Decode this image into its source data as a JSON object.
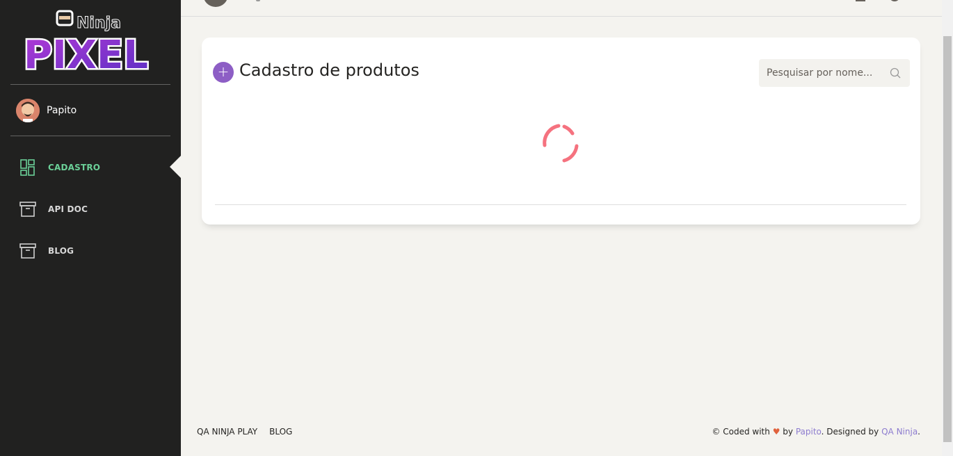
{
  "brand": {
    "logo_top": "Ninja",
    "logo_bottom": "PIXEL"
  },
  "user": {
    "name": "Papito"
  },
  "sidebar": {
    "items": [
      {
        "label": "CADASTRO",
        "icon": "dashboard-grid-icon",
        "active": true
      },
      {
        "label": "API DOC",
        "icon": "archive-box-icon",
        "active": false
      },
      {
        "label": "BLOG",
        "icon": "archive-box-icon",
        "active": false
      }
    ]
  },
  "main": {
    "title": "Cadastro de produtos",
    "add_label": "+",
    "search": {
      "placeholder": "Pesquisar por nome..."
    },
    "loading_icon": "spinner-icon"
  },
  "footer": {
    "links": [
      "QA NINJA PLAY",
      "BLOG"
    ],
    "copyright_prefix": "© Coded with",
    "heart": "♥",
    "by": "by",
    "author": "Papito",
    "designed_by": ". Designed by",
    "designer": "QA Ninja",
    "end": "."
  },
  "colors": {
    "sidebar_bg": "#212120",
    "active_nav": "#6bd098",
    "accent_purple": "#8d5ec5",
    "spinner": "#f5727f",
    "link": "#8d7ccf",
    "heart": "#e0623d"
  }
}
